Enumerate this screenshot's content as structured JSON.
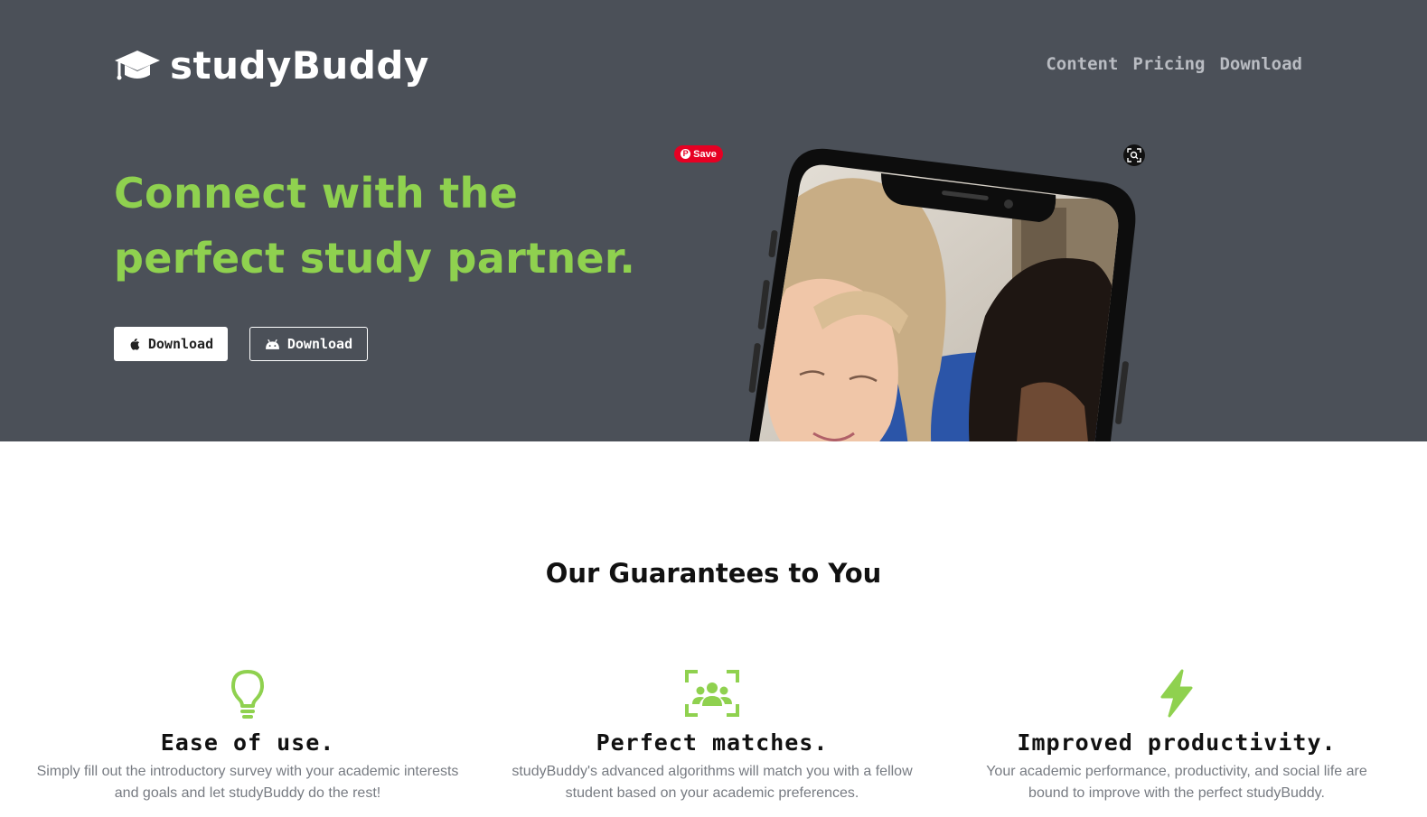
{
  "brand": {
    "name": "studyBuddy",
    "icon": "graduation-cap-icon"
  },
  "nav": {
    "items": [
      "Content",
      "Pricing",
      "Download"
    ]
  },
  "hero": {
    "headline_line1": "Connect with the",
    "headline_line2": "perfect study partner.",
    "btn_ios_label": "Download",
    "btn_android_label": "Download",
    "pin_save_label": "Save"
  },
  "colors": {
    "hero_bg": "#4b5058",
    "accent": "#8fd14f",
    "pinterest": "#e60023"
  },
  "guarantees": {
    "title": "Our Guarantees to You",
    "items": [
      {
        "icon": "lightbulb-icon",
        "title": "Ease of use.",
        "text": "Simply fill out the introductory survey with your academic interests and goals and let studyBuddy do the rest!"
      },
      {
        "icon": "users-scan-icon",
        "title": "Perfect matches.",
        "text": "studyBuddy's advanced algorithms will match you with a fellow student based on your academic preferences."
      },
      {
        "icon": "bolt-icon",
        "title": "Improved productivity.",
        "text": "Your academic performance, productivity, and social life are bound to improve with the perfect studyBuddy."
      }
    ]
  }
}
